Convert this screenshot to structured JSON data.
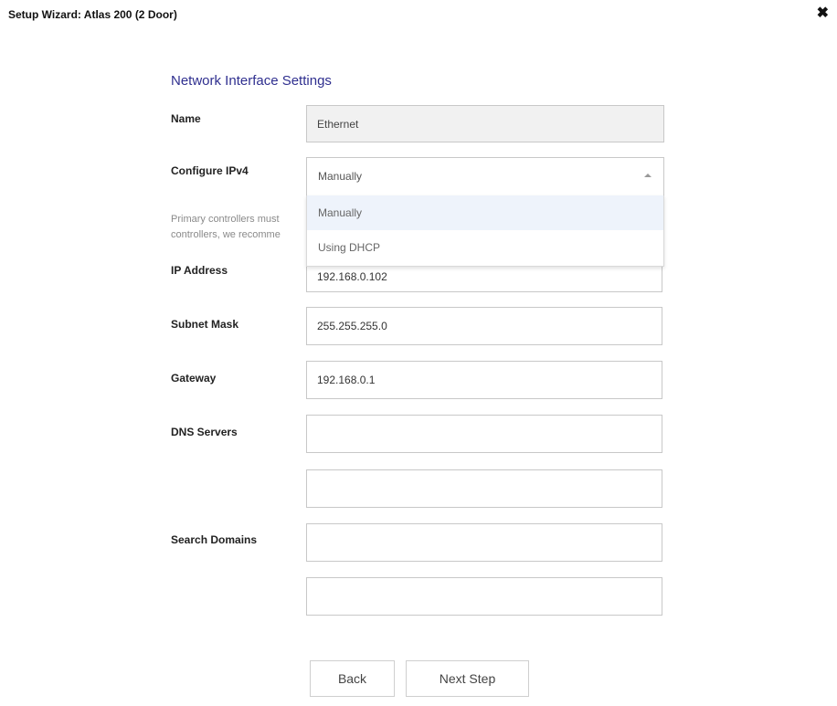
{
  "window": {
    "title": "Setup Wizard: Atlas 200 (2 Door)",
    "close_symbol": "✖"
  },
  "form": {
    "heading": "Network Interface Settings",
    "name": {
      "label": "Name",
      "value": "Ethernet"
    },
    "configure_ipv4": {
      "label": "Configure IPv4",
      "selected": "Manually",
      "options": [
        "Manually",
        "Using DHCP"
      ],
      "help_line1": "Primary controllers must",
      "help_line2": "controllers, we recomme"
    },
    "ip_address": {
      "label": "IP Address",
      "value": "192.168.0.102"
    },
    "subnet_mask": {
      "label": "Subnet Mask",
      "value": "255.255.255.0"
    },
    "gateway": {
      "label": "Gateway",
      "value": "192.168.0.1"
    },
    "dns_servers": {
      "label": "DNS Servers",
      "value1": "",
      "value2": ""
    },
    "search_domains": {
      "label": "Search Domains",
      "value1": "",
      "value2": ""
    }
  },
  "buttons": {
    "back": "Back",
    "next": "Next Step"
  }
}
